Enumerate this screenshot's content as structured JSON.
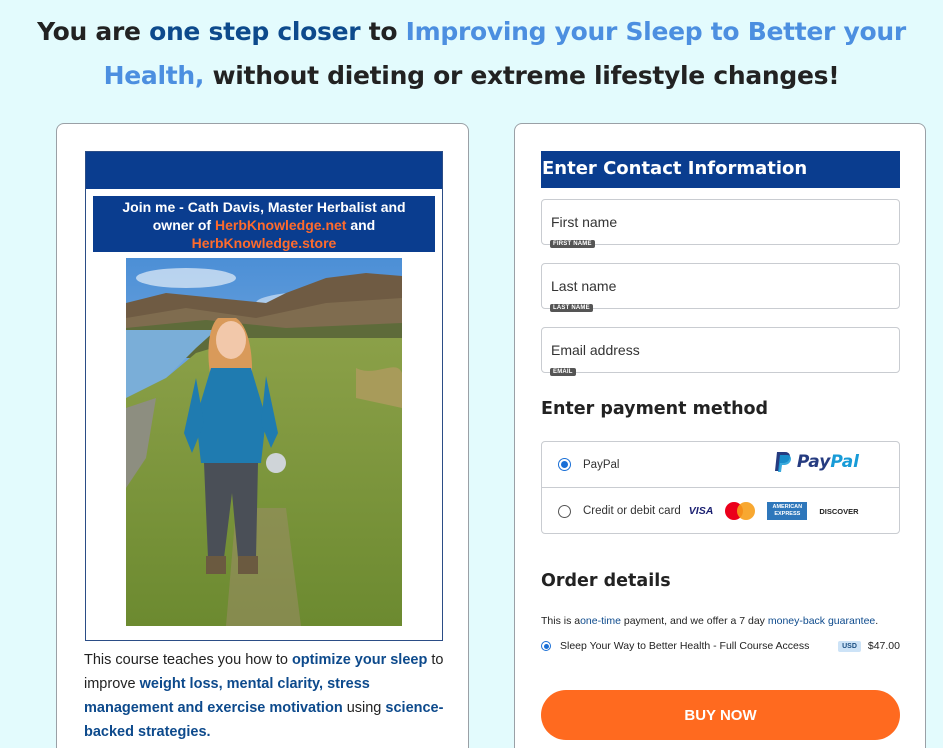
{
  "headline": {
    "part1": "You are ",
    "part2": "one step closer",
    "part3": " to ",
    "part4": "Improving your Sleep to Better your Health,",
    "part5": " without dieting or extreme lifestyle changes!"
  },
  "promo": {
    "line1": "Join me -  Cath Davis, Master Herbalist and",
    "line2_a": "owner of ",
    "line2_b": "HerbKnowledge.net",
    "line2_c": " and",
    "line3": "HerbKnowledge.store"
  },
  "course": {
    "t1": "This course teaches you how to ",
    "h1": "optimize your sleep",
    "t2": " to improve ",
    "h2": "weight loss, mental clarity, stress management and exercise motivation",
    "t3": " using ",
    "h3": "science-backed strategies."
  },
  "contact": {
    "title": "Enter Contact Information",
    "first_name_placeholder": "First name",
    "first_name_tag": "First name",
    "last_name_placeholder": "Last name",
    "last_name_tag": "Last name",
    "email_placeholder": "Email address",
    "email_tag": "Email"
  },
  "payment": {
    "title": "Enter payment method",
    "paypal_label": "PayPal",
    "paypal_logo_a": "Pay",
    "paypal_logo_b": "Pal",
    "card_label": "Credit or debit card",
    "visa": "VISA",
    "amex": "AMERICAN EXPRESS",
    "discover": "DISCOVER"
  },
  "order": {
    "title": "Order details",
    "text1": "This is a",
    "text2": "one-time",
    "text3": " payment, and we offer a 7 day ",
    "text4": "money-back guarantee",
    "text5": ".",
    "item_name": "Sleep Your Way to Better Health - Full Course Access",
    "currency": "USD",
    "price": "$47.00"
  },
  "buy_label": "BUY NOW",
  "icons": {
    "selected_radio": "radio-selected-icon",
    "unselected_radio": "radio-unselected-icon",
    "paypal": "paypal-logo-icon",
    "mastercard": "mastercard-logo-icon"
  }
}
